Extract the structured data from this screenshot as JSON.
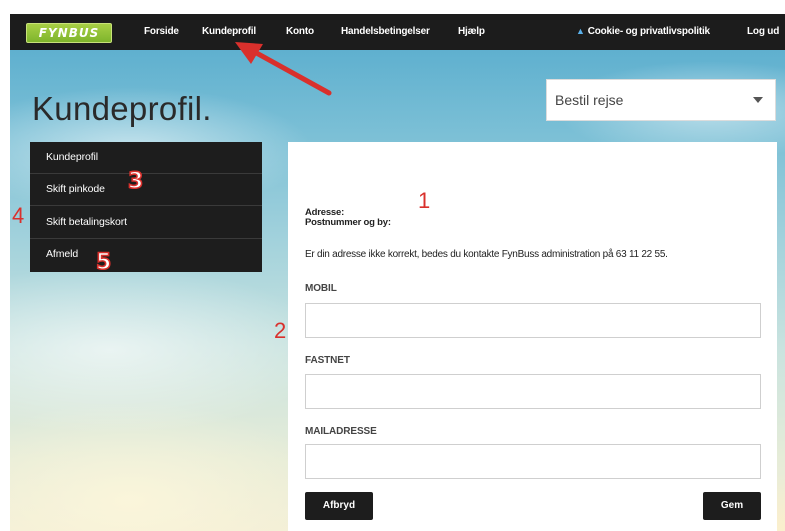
{
  "navbar": {
    "logo": "FYNBUS",
    "items": [
      {
        "label": "Forside"
      },
      {
        "label": "Kundeprofil"
      },
      {
        "label": "Konto"
      },
      {
        "label": "Handelsbetingelser"
      },
      {
        "label": "Hjælp"
      }
    ],
    "cookie_label": "Cookie- og privatlivspolitik",
    "logout_label": "Log ud"
  },
  "page": {
    "title": "Kundeprofil."
  },
  "dropdown": {
    "selected": "Bestil rejse"
  },
  "sidebar": {
    "items": [
      {
        "label": "Kundeprofil"
      },
      {
        "label": "Skift pinkode"
      },
      {
        "label": "Skift betalingskort"
      },
      {
        "label": "Afmeld"
      }
    ]
  },
  "profile": {
    "address_label": "Adresse:",
    "postal_label": "Postnummer og by:",
    "info_text": "Er din adresse ikke korrekt, bedes du kontakte FynBuss administration på 63 11 22 55.",
    "fields": [
      {
        "label": "MOBIL",
        "value": "",
        "placeholder": ""
      },
      {
        "label": "FASTNET",
        "value": "",
        "placeholder": ""
      },
      {
        "label": "MAILADRESSE",
        "value": "",
        "placeholder": ""
      }
    ],
    "cancel_label": "Afbryd",
    "save_label": "Gem"
  },
  "annotations": {
    "n1": "1",
    "n2": "2",
    "n3": "3",
    "n4": "4",
    "n5": "5"
  },
  "colors": {
    "navbar_bg": "#1c1c1c",
    "logo_green": "#8cc63f",
    "annotation_red": "#d9302c",
    "cookie_icon": "#5ab0ea"
  },
  "icons": {
    "warning": "warning-triangle-icon",
    "caret": "chevron-down-icon",
    "arrow": "red-pointer-arrow"
  }
}
